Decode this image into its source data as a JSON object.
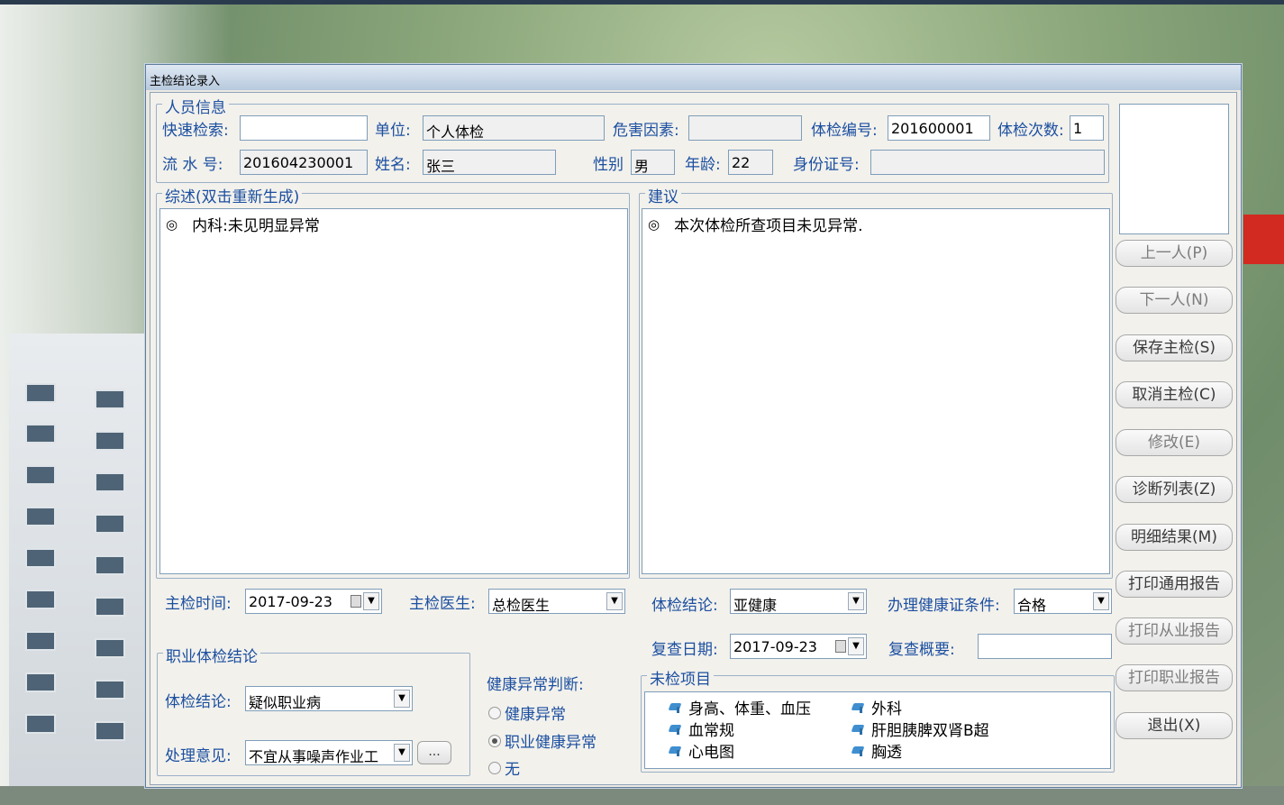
{
  "window": {
    "title": "主检结论录入"
  },
  "person": {
    "group_title": "人员信息",
    "quick_search_label": "快速检索:",
    "quick_search_value": "",
    "unit_label": "单位:",
    "unit_value": "个人体检",
    "hazard_label": "危害因素:",
    "hazard_value": "",
    "exam_no_label": "体检编号:",
    "exam_no_value": "201600001",
    "exam_count_label": "体检次数:",
    "exam_count_value": "1",
    "serial_label": "流 水 号:",
    "serial_value": "201604230001",
    "name_label": "姓名:",
    "name_value": "张三",
    "gender_label": "性别",
    "gender_value": "男",
    "age_label": "年龄:",
    "age_value": "22",
    "id_label": "身份证号:",
    "id_value": ""
  },
  "summary": {
    "title": "综述(双击重新生成)",
    "bullet": "◎",
    "line1": "内科:未见明显异常"
  },
  "advice": {
    "title": "建议",
    "bullet": "◎",
    "line1": "本次体检所查项目未见异常."
  },
  "exam_time": {
    "label": "主检时间:",
    "value": "2017-09-23"
  },
  "doctor": {
    "label": "主检医生:",
    "value": "总检医生"
  },
  "conclusion": {
    "label": "体检结论:",
    "value": "亚健康"
  },
  "health_cert": {
    "label": "办理健康证条件:",
    "value": "合格"
  },
  "recheck": {
    "date_label": "复查日期:",
    "date_value": "2017-09-23",
    "summary_label": "复查概要:",
    "summary_value": ""
  },
  "occupational": {
    "title": "职业体检结论",
    "conclusion_label": "体检结论:",
    "conclusion_value": "疑似职业病",
    "opinion_label": "处理意见:",
    "opinion_value": "不宜从事噪声作业工",
    "dots": "..."
  },
  "abnormal": {
    "label": "健康异常判断:",
    "options": [
      "健康异常",
      "职业健康异常",
      "无"
    ],
    "selected": "职业健康异常"
  },
  "pending": {
    "title": "未检项目",
    "items": [
      "身高、体重、血压",
      "外科",
      "血常规",
      "肝胆胰脾双肾B超",
      "心电图",
      "胸透"
    ]
  },
  "buttons": {
    "prev": "上一人(P)",
    "next": "下一人(N)",
    "save": "保存主检(S)",
    "cancel": "取消主检(C)",
    "edit": "修改(E)",
    "diag_list": "诊断列表(Z)",
    "detail": "明细结果(M)",
    "print_general": "打印通用报告",
    "print_employ": "打印从业报告",
    "print_occupation": "打印职业报告",
    "exit": "退出(X)"
  },
  "colors": {
    "label_blue": "#1c4fa0",
    "title_bar": "#b7c9dd",
    "border": "#7f9db9"
  },
  "icons": {
    "pending_item": "person-pointer-icon",
    "calendar": "calendar-icon",
    "combo": "chevron-down-icon"
  }
}
